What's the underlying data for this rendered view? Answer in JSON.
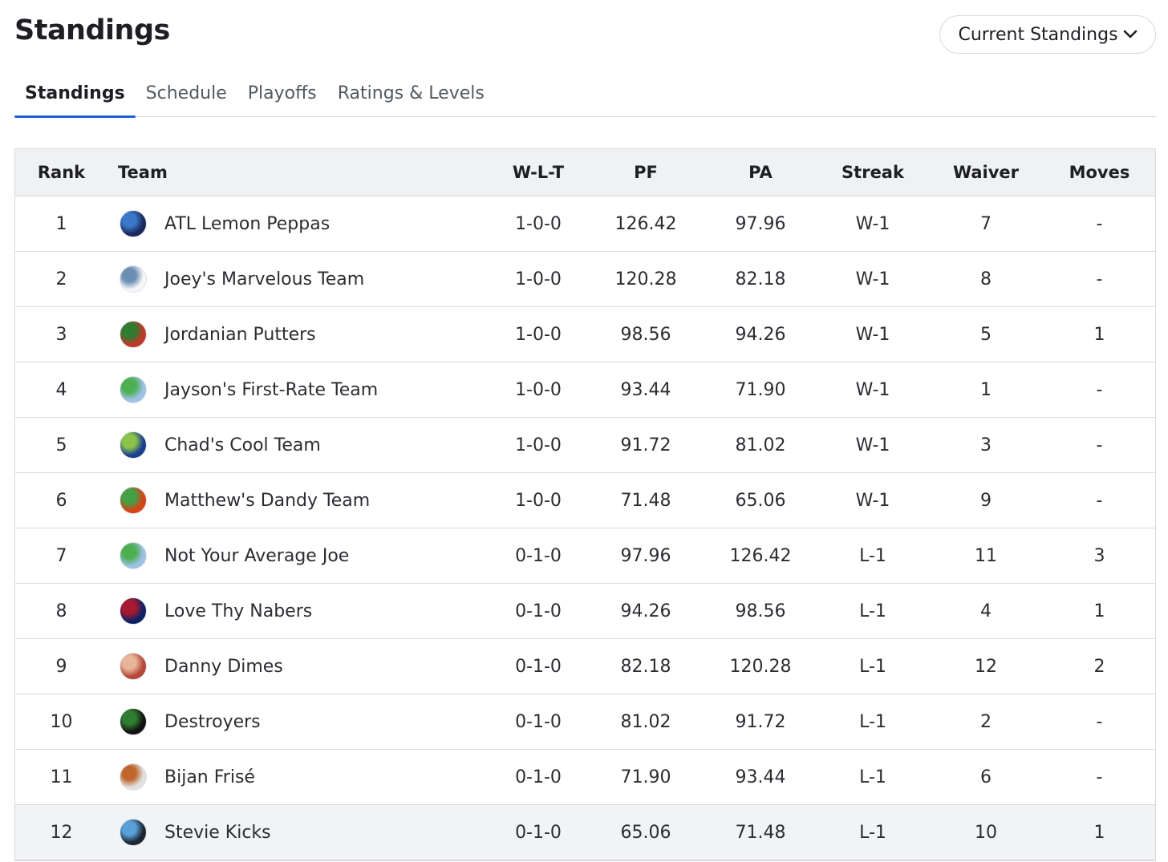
{
  "page": {
    "title": "Standings"
  },
  "view_select": {
    "label": "Current Standings",
    "icon": "chevron-down-icon"
  },
  "tabs": [
    {
      "label": "Standings",
      "active": true
    },
    {
      "label": "Schedule",
      "active": false
    },
    {
      "label": "Playoffs",
      "active": false
    },
    {
      "label": "Ratings & Levels",
      "active": false
    }
  ],
  "table": {
    "headers": {
      "rank": "Rank",
      "team": "Team",
      "wlt": "W-L-T",
      "pf": "PF",
      "pa": "PA",
      "streak": "Streak",
      "waiver": "Waiver",
      "moves": "Moves"
    },
    "rows": [
      {
        "rank": "1",
        "team": "ATL Lemon Peppas",
        "wlt": "1-0-0",
        "pf": "126.42",
        "pa": "97.96",
        "streak": "W-1",
        "waiver": "7",
        "moves": "-",
        "logo_colors": [
          "#1b2a5c",
          "#3b78c9"
        ]
      },
      {
        "rank": "2",
        "team": "Joey's Marvelous Team",
        "wlt": "1-0-0",
        "pf": "120.28",
        "pa": "82.18",
        "streak": "W-1",
        "waiver": "8",
        "moves": "-",
        "logo_colors": [
          "#f4f6f8",
          "#6b8fb3"
        ]
      },
      {
        "rank": "3",
        "team": "Jordanian Putters",
        "wlt": "1-0-0",
        "pf": "98.56",
        "pa": "94.26",
        "streak": "W-1",
        "waiver": "5",
        "moves": "1",
        "logo_colors": [
          "#c0392b",
          "#2e7d32"
        ]
      },
      {
        "rank": "4",
        "team": "Jayson's First-Rate Team",
        "wlt": "1-0-0",
        "pf": "93.44",
        "pa": "71.90",
        "streak": "W-1",
        "waiver": "1",
        "moves": "-",
        "logo_colors": [
          "#9ec1e6",
          "#4caf50"
        ]
      },
      {
        "rank": "5",
        "team": "Chad's Cool Team",
        "wlt": "1-0-0",
        "pf": "91.72",
        "pa": "81.02",
        "streak": "W-1",
        "waiver": "3",
        "moves": "-",
        "logo_colors": [
          "#1a3f8f",
          "#8bc34a"
        ]
      },
      {
        "rank": "6",
        "team": "Matthew's Dandy Team",
        "wlt": "1-0-0",
        "pf": "71.48",
        "pa": "65.06",
        "streak": "W-1",
        "waiver": "9",
        "moves": "-",
        "logo_colors": [
          "#d84315",
          "#43a047"
        ]
      },
      {
        "rank": "7",
        "team": "Not Your Average Joe",
        "wlt": "0-1-0",
        "pf": "97.96",
        "pa": "126.42",
        "streak": "L-1",
        "waiver": "11",
        "moves": "3",
        "logo_colors": [
          "#9ec1e6",
          "#4caf50"
        ]
      },
      {
        "rank": "8",
        "team": "Love Thy Nabers",
        "wlt": "0-1-0",
        "pf": "94.26",
        "pa": "98.56",
        "streak": "L-1",
        "waiver": "4",
        "moves": "1",
        "logo_colors": [
          "#0b2265",
          "#a71930"
        ]
      },
      {
        "rank": "9",
        "team": "Danny Dimes",
        "wlt": "0-1-0",
        "pf": "82.18",
        "pa": "120.28",
        "streak": "L-1",
        "waiver": "12",
        "moves": "2",
        "logo_colors": [
          "#b5483a",
          "#e8b59a"
        ]
      },
      {
        "rank": "10",
        "team": "Destroyers",
        "wlt": "0-1-0",
        "pf": "81.02",
        "pa": "91.72",
        "streak": "L-1",
        "waiver": "2",
        "moves": "-",
        "logo_colors": [
          "#111111",
          "#2e7d32"
        ]
      },
      {
        "rank": "11",
        "team": "Bijan Frisé",
        "wlt": "0-1-0",
        "pf": "71.90",
        "pa": "93.44",
        "streak": "L-1",
        "waiver": "6",
        "moves": "-",
        "logo_colors": [
          "#e0e0e0",
          "#c0652b"
        ]
      },
      {
        "rank": "12",
        "team": "Stevie Kicks",
        "wlt": "0-1-0",
        "pf": "65.06",
        "pa": "71.48",
        "streak": "L-1",
        "waiver": "10",
        "moves": "1",
        "logo_colors": [
          "#1c2733",
          "#5aa0d8"
        ],
        "highlighted": true
      }
    ]
  },
  "colors": {
    "accent": "#1f5fd6",
    "header_bg": "#f0f1f3",
    "border": "#d9dbdf"
  }
}
